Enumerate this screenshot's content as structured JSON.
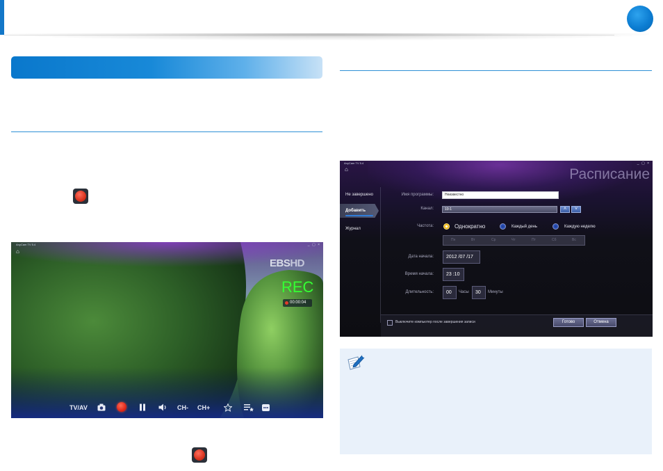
{
  "header": {
    "accent_color": "#1377c8",
    "chapter_marker_color": "#0c7dd2"
  },
  "left": {
    "record_icon_name": "record-button-icon",
    "tv_screen": {
      "app_title": "AnyCam TV 5.4",
      "window_controls": "_ ▢ ×",
      "home_icon": "⌂",
      "channel_logo": {
        "main": "EBS",
        "suffix": "HD"
      },
      "rec_label": "REC",
      "rec_time": "00:00:04",
      "toolbar": {
        "tv_av": "TV/AV",
        "camera_icon": "camera-icon",
        "record_icon": "record-icon",
        "pause_icon": "pause-icon",
        "volume_icon": "volume-icon",
        "ch_minus": "CH-",
        "ch_plus": "CH+",
        "favorite_icon": "star-icon",
        "list_icon": "favorites-list-icon",
        "more_icon": "more-icon"
      }
    }
  },
  "right": {
    "schedule_screen": {
      "app_title": "AnyCam TV 5.4",
      "window_controls": "_ ▢ ×",
      "home_icon": "⌂",
      "heading": "Расписание",
      "sidebar": [
        "Не завершено",
        "Добавить",
        "Журнал"
      ],
      "fields": {
        "program_name_label": "Имя программы:",
        "program_name_value": "Неизвестно",
        "channel_label": "Канал:",
        "channel_value": "10-1",
        "frequency_label": "Частота:",
        "freq_once": "Однократно",
        "freq_daily": "Каждый день",
        "freq_weekly": "Каждую неделю",
        "days": [
          "Пн",
          "Вт",
          "Ср",
          "Чт",
          "Пт",
          "Сб",
          "Вс"
        ],
        "start_date_label": "Дата начала:",
        "start_date_value": "2012 /07 /17",
        "start_time_label": "Время начала:",
        "start_time_value": "23 :10",
        "duration_label": "Длительность:",
        "duration_hours": "00",
        "hours_unit": "Часы",
        "duration_minutes": "30",
        "minutes_unit": "Минуты"
      },
      "footer": {
        "shutdown_label": "Выключите компьютер после завершения записи",
        "done_button": "Готово",
        "cancel_button": "Отмена"
      }
    }
  }
}
